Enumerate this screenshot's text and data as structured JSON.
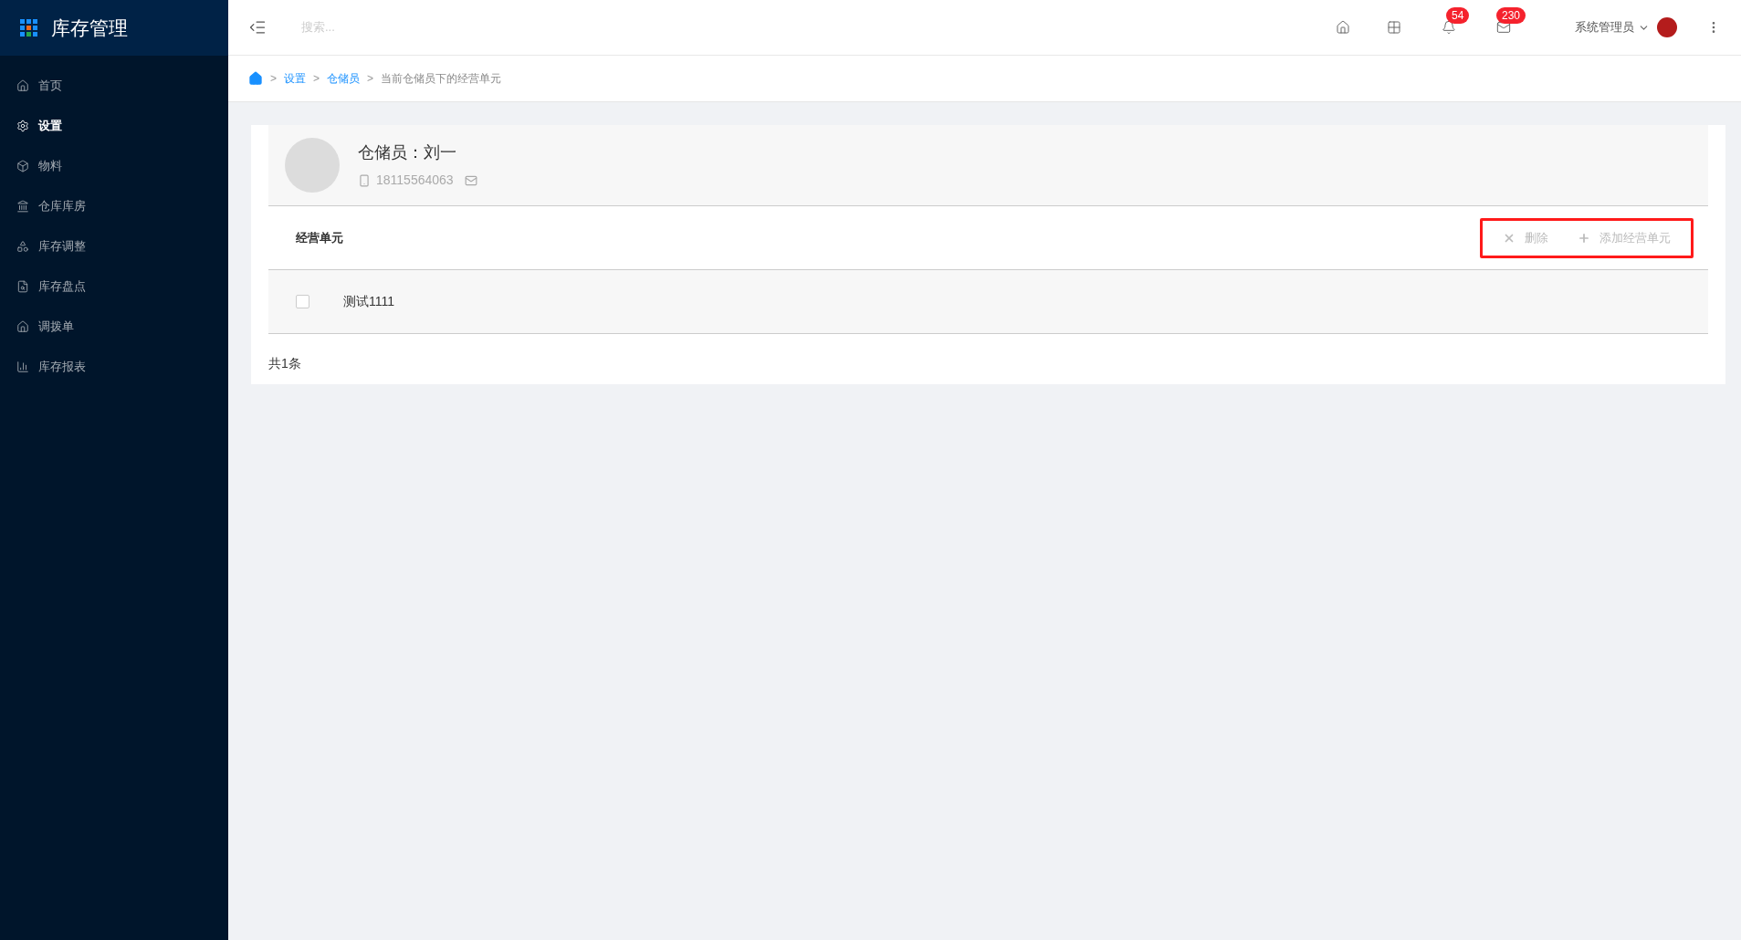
{
  "app": {
    "title": "库存管理"
  },
  "sidebar": {
    "items": [
      {
        "label": "首页",
        "selected": false
      },
      {
        "label": "设置",
        "selected": true
      },
      {
        "label": "物料",
        "selected": false
      },
      {
        "label": "仓库库房",
        "selected": false
      },
      {
        "label": "库存调整",
        "selected": false
      },
      {
        "label": "库存盘点",
        "selected": false
      },
      {
        "label": "调拨单",
        "selected": false
      },
      {
        "label": "库存报表",
        "selected": false
      }
    ]
  },
  "topbar": {
    "search": {
      "placeholder": "搜索..."
    },
    "notifications": "54",
    "messages": "230",
    "user": "系统管理员"
  },
  "breadcrumb": [
    {
      "separator": ">",
      "label": "设置",
      "link": true
    },
    {
      "separator": ">",
      "label": "仓储员",
      "link": true
    },
    {
      "separator": ">",
      "label": "当前仓储员下的经营单元",
      "link": false
    }
  ],
  "profile": {
    "title": "仓储员：刘一",
    "phone": "18115564063"
  },
  "section": {
    "title": "经营单元",
    "actions": [
      {
        "label": "删除"
      },
      {
        "label": "添加经营单元"
      }
    ]
  },
  "rows": [
    {
      "name": "测试1111",
      "checked": false
    }
  ],
  "total": "共1条"
}
